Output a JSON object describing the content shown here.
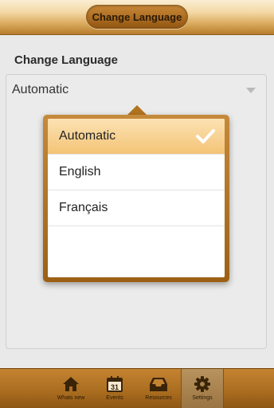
{
  "header": {
    "title": "Change Language"
  },
  "section": {
    "title": "Change Language"
  },
  "select": {
    "value": "Automatic",
    "arrow_icon": "chevron-down-icon"
  },
  "popup": {
    "options": [
      {
        "label": "Automatic",
        "selected": true
      },
      {
        "label": "English",
        "selected": false
      },
      {
        "label": "Français",
        "selected": false
      }
    ],
    "check_icon": "checkmark-icon"
  },
  "nav": {
    "tabs": [
      {
        "label": "Whats new",
        "icon": "home-icon"
      },
      {
        "label": "Events",
        "icon": "calendar-icon",
        "icon_text": "31"
      },
      {
        "label": "Resources",
        "icon": "inbox-icon"
      },
      {
        "label": "Settings",
        "icon": "gear-icon",
        "active": true
      }
    ]
  },
  "colors": {
    "accent": "#b06f23",
    "selected_option": "#f4c476",
    "background": "#e9e9e9"
  }
}
